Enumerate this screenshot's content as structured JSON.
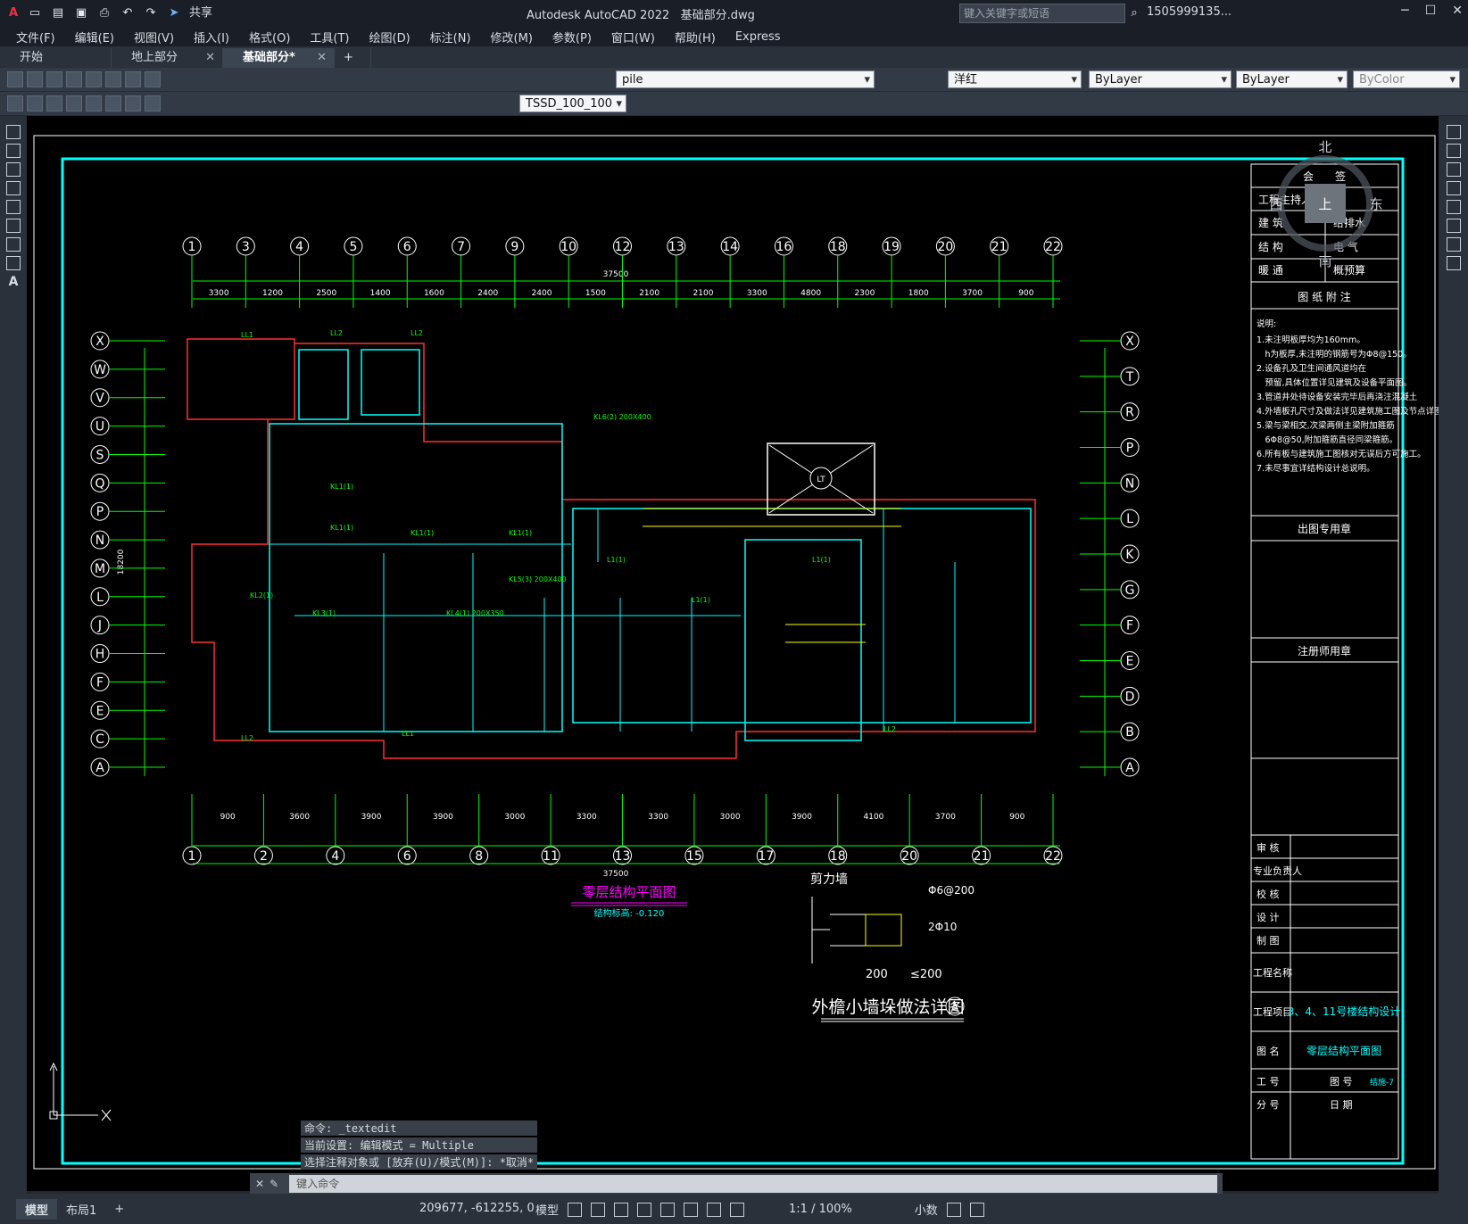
{
  "title": {
    "app": "Autodesk AutoCAD 2022",
    "file": "基础部分.dwg",
    "share": "共享",
    "search_placeholder": "键入关键字或短语",
    "user": "1505999135..."
  },
  "menu": [
    "文件(F)",
    "编辑(E)",
    "视图(V)",
    "插入(I)",
    "格式(O)",
    "工具(T)",
    "绘图(D)",
    "标注(N)",
    "修改(M)",
    "参数(P)",
    "窗口(W)",
    "帮助(H)",
    "Express"
  ],
  "tabs": [
    {
      "label": "开始"
    },
    {
      "label": "地上部分"
    },
    {
      "label": "基础部分*"
    }
  ],
  "toolbar": {
    "layer_name": "pile",
    "color": "洋红",
    "linetype": "ByLayer",
    "lineweight": "ByLayer",
    "plotstyle": "ByColor",
    "dim_style": "TSSD_100_100"
  },
  "colors": {
    "cyan": "#00ffff",
    "green": "#00ff00",
    "magenta": "#ff00ff",
    "red": "#ff3030"
  },
  "viewcube": {
    "north": "北",
    "south": "南",
    "east": "东",
    "west": "西",
    "top": "上"
  },
  "drawing": {
    "title_main": "零层结构平面图",
    "elevation": "结构标高: -0.120",
    "detail_title": "外檐小墙垛做法详图",
    "detail_tag": "A",
    "detail_labels": {
      "shear_wall": "剪力墙",
      "stirrup": "Φ6@200",
      "bars": "2Φ10",
      "dim_a": "200",
      "dim_b": "≤200"
    },
    "total_top": "37500",
    "total_bottom": "37500",
    "total_side": "18200",
    "top_axes": [
      "1",
      "3",
      "4",
      "5",
      "6",
      "7",
      "9",
      "10",
      "12",
      "13",
      "14",
      "16",
      "18",
      "19",
      "20",
      "21",
      "22"
    ],
    "top_dims": [
      "3300",
      "1200",
      "2500",
      "1400",
      "1600",
      "2400",
      "2400",
      "1500",
      "2100",
      "2100",
      "3300",
      "4800",
      "2300",
      "1800",
      "3700",
      "900"
    ],
    "bottom_axes": [
      "1",
      "2",
      "4",
      "6",
      "8",
      "11",
      "13",
      "15",
      "17",
      "18",
      "20",
      "21",
      "22"
    ],
    "bottom_dims": [
      "900",
      "3600",
      "3900",
      "3900",
      "3000",
      "3300",
      "3300",
      "3000",
      "3900",
      "4100",
      "3700",
      "900"
    ],
    "left_axes": [
      "X",
      "W",
      "V",
      "U",
      "S",
      "Q",
      "P",
      "N",
      "M",
      "L",
      "J",
      "H",
      "F",
      "E",
      "C",
      "A"
    ],
    "right_axes": [
      "X",
      "T",
      "R",
      "P",
      "N",
      "L",
      "K",
      "G",
      "F",
      "E",
      "D",
      "B",
      "A"
    ],
    "labels": [
      "KL1(1)",
      "KL1(1)",
      "KL1(1)",
      "KL1(1)",
      "KL2(1)",
      "KL3(1)",
      "KL4(1) 200X350",
      "KL5(3) 200X400",
      "KL6(2) 200X400",
      "L1(1)",
      "L1(1)",
      "L1(1)",
      "LL1",
      "LL2",
      "LL2",
      "LL2",
      "LL1",
      "LL2"
    ]
  },
  "titleblock": {
    "sign_header": "会　　签",
    "roles": [
      "工程主持人",
      "建 筑",
      "结 构",
      "暖 通"
    ],
    "roles_right": [
      "给排水",
      "电 气",
      "概预算"
    ],
    "notes_title": "图 纸 附 注",
    "notes": [
      "说明:",
      "1.未注明板厚均为160mm。",
      "　h为板厚,未注明的钢筋号为Φ8@150。",
      "2.设备孔及卫生间通风道均在",
      "　预留,具体位置详见建筑及设备平面图。",
      "3.管道井处待设备安装完毕后再浇注混凝土",
      "4.外墙板孔尺寸及做法详见建筑施工图及节点详图。",
      "5.梁与梁相交,次梁两侧主梁附加箍筋",
      "　6Φ8@50,附加箍筋直径同梁箍筋。",
      "6.所有板与建筑施工图核对无误后方可施工。",
      "7.未尽事宜详结构设计总说明。"
    ],
    "stamp1": "出图专用章",
    "stamp2": "注册师用章",
    "approvals": [
      "审 核",
      "专业负责人",
      "校 核",
      "设 计",
      "制 图"
    ],
    "project_name_label": "工程名称",
    "project_item_label": "工程项目",
    "project_item": "3、4、11号楼结构设计",
    "drawing_name_label": "图 名",
    "drawing_name": "零层结构平面图",
    "job_label": "工 号",
    "sheet_label": "图 号",
    "sheet_no": "结施-7",
    "sub_label": "分 号",
    "date_label": "日 期"
  },
  "command": {
    "history": [
      "命令: _textedit",
      "当前设置: 编辑模式 = Multiple",
      "选择注释对象或 [放弃(U)/模式(M)]: *取消*"
    ],
    "placeholder": "键入命令"
  },
  "status": {
    "tabs": [
      "模型",
      "布局1"
    ],
    "coords": "209677, -612255, 0",
    "model": "模型",
    "scale": "1:1 / 100%",
    "units": "小数"
  }
}
